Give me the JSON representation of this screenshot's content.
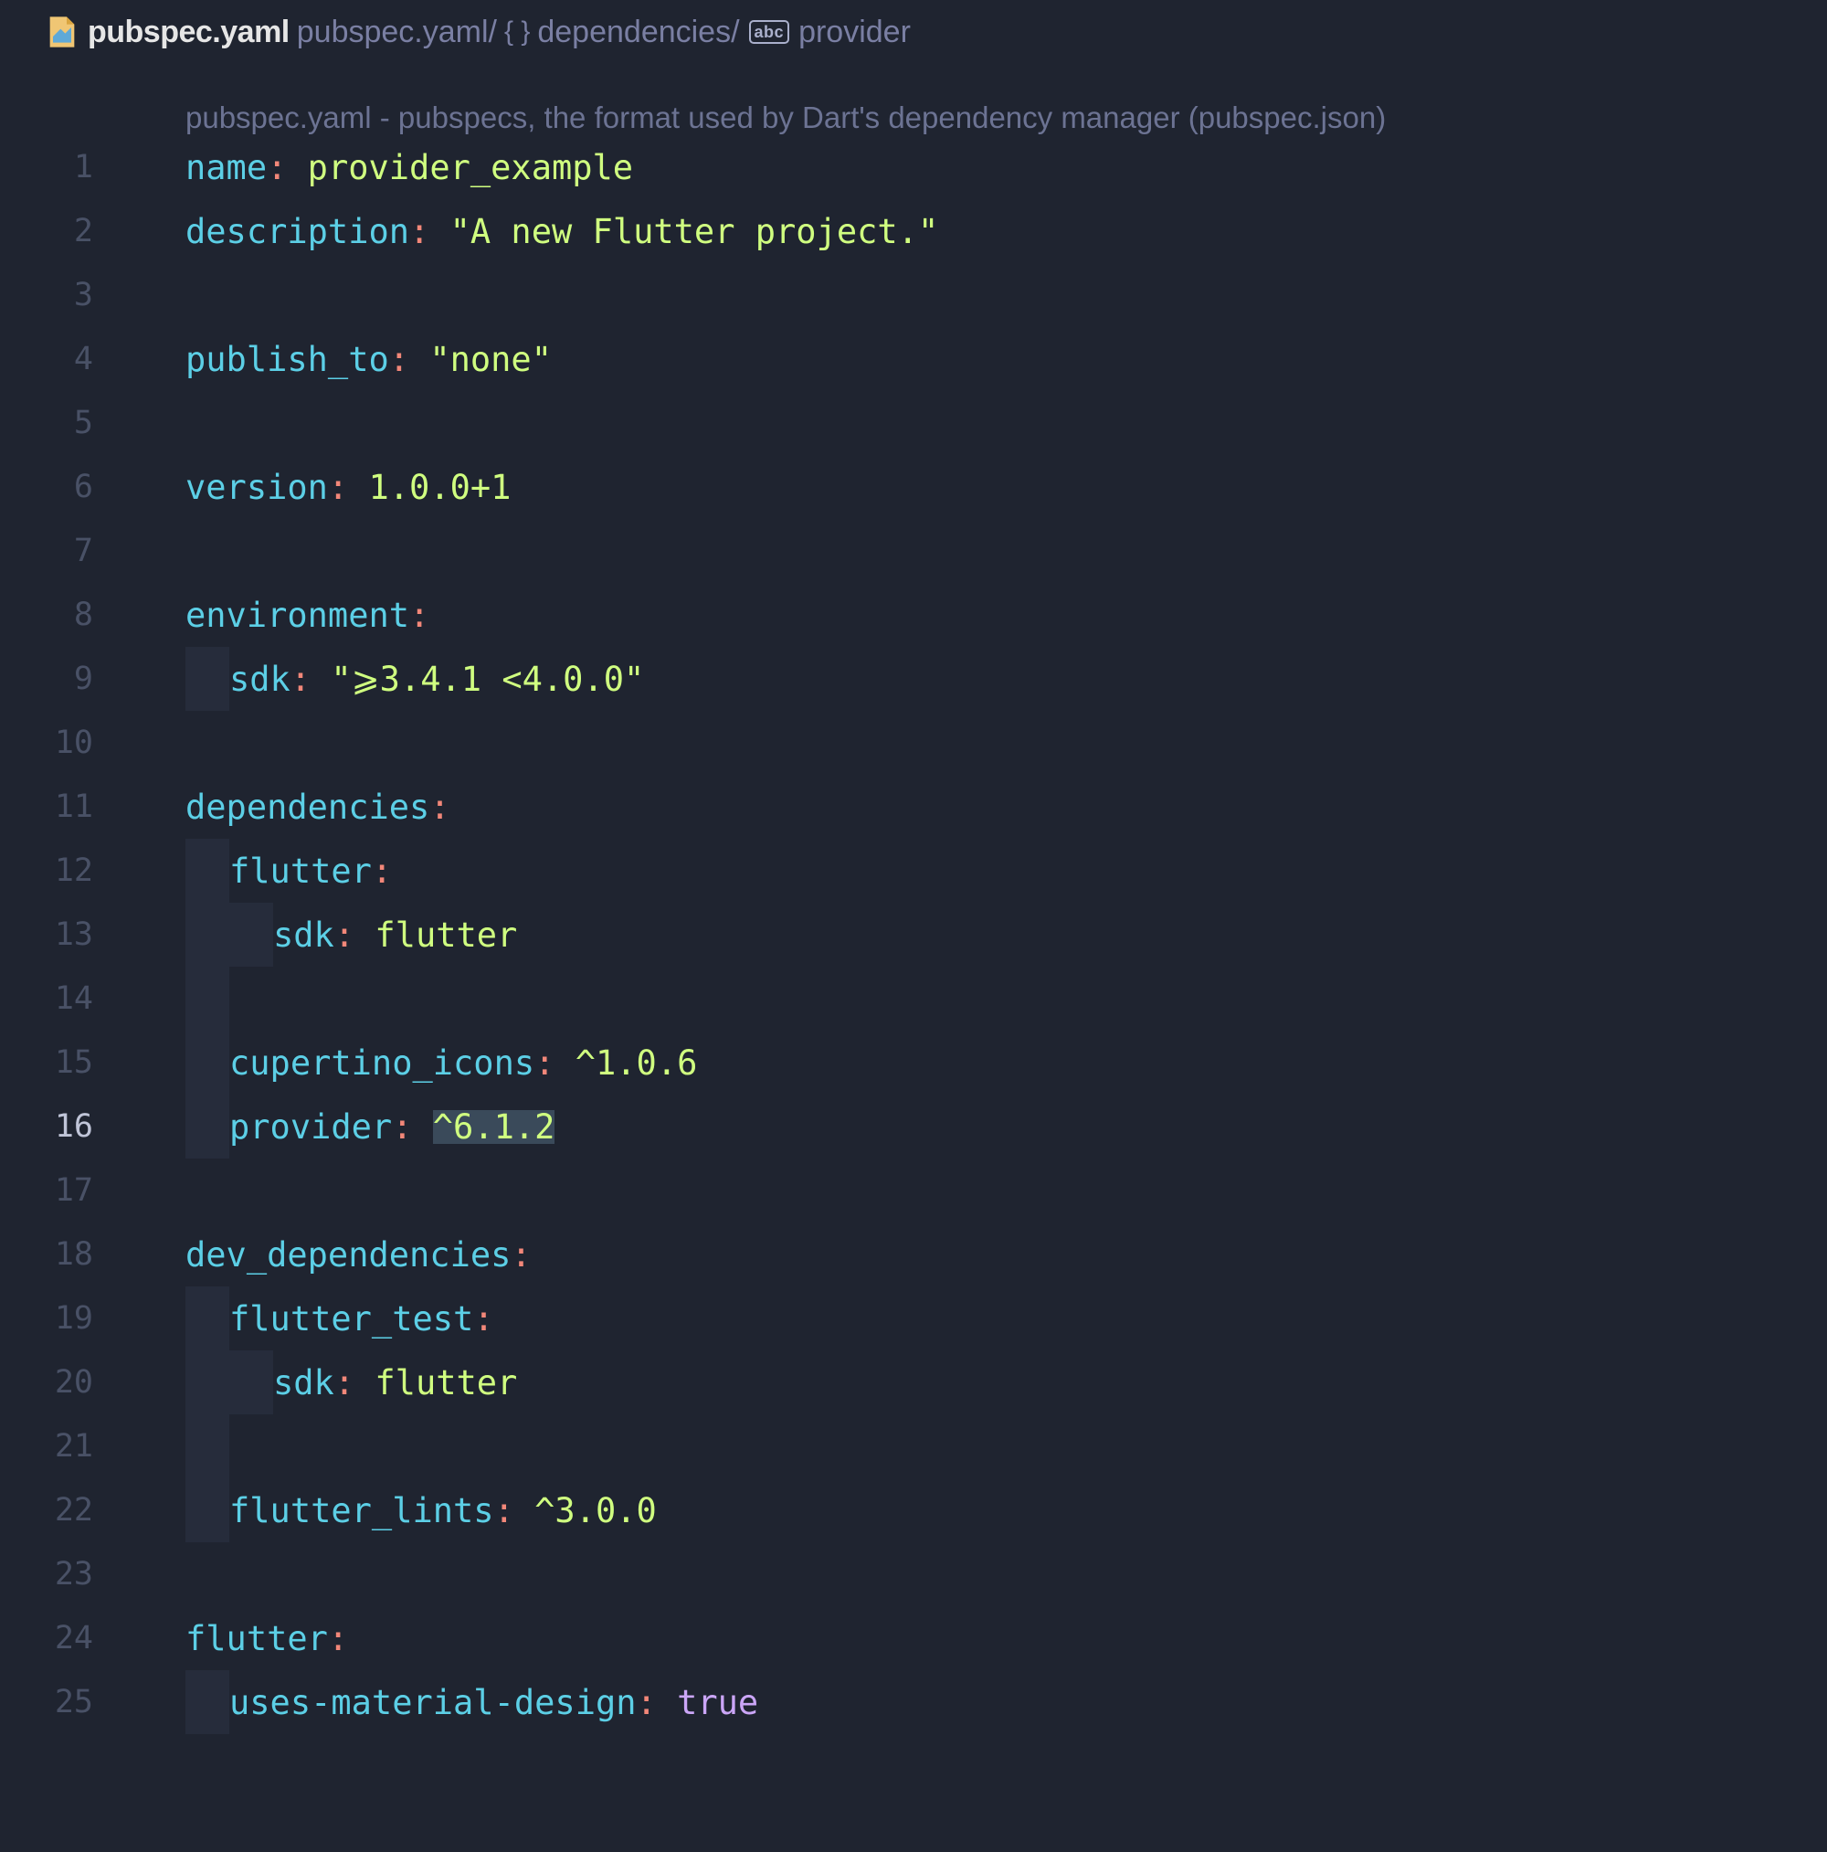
{
  "breadcrumb": {
    "file_active": "pubspec.yaml",
    "file_inactive": "pubspec.yaml/",
    "braces_label": "{ }",
    "path_segment": "dependencies/",
    "abc_badge": "abc",
    "final_segment": "provider"
  },
  "hint": "pubspec.yaml - pubspecs, the format used by Dart's dependency manager (pubspec.json)",
  "code": {
    "current_line": 16,
    "lines": [
      {
        "n": "1",
        "indent": 0,
        "segs": [
          {
            "t": "name",
            "c": "tok-key"
          },
          {
            "t": ":",
            "c": "tok-colon"
          },
          {
            "t": " ",
            "c": ""
          },
          {
            "t": "provider_example",
            "c": "tok-val"
          }
        ]
      },
      {
        "n": "2",
        "indent": 0,
        "segs": [
          {
            "t": "description",
            "c": "tok-key"
          },
          {
            "t": ":",
            "c": "tok-colon"
          },
          {
            "t": " ",
            "c": ""
          },
          {
            "t": "\"A new Flutter project.\"",
            "c": "tok-str"
          }
        ]
      },
      {
        "n": "3",
        "indent": 0,
        "segs": []
      },
      {
        "n": "4",
        "indent": 0,
        "segs": [
          {
            "t": "publish_to",
            "c": "tok-key"
          },
          {
            "t": ":",
            "c": "tok-colon"
          },
          {
            "t": " ",
            "c": ""
          },
          {
            "t": "\"none\"",
            "c": "tok-str"
          }
        ]
      },
      {
        "n": "5",
        "indent": 0,
        "segs": []
      },
      {
        "n": "6",
        "indent": 0,
        "segs": [
          {
            "t": "version",
            "c": "tok-key"
          },
          {
            "t": ":",
            "c": "tok-colon"
          },
          {
            "t": " ",
            "c": ""
          },
          {
            "t": "1.0.0+1",
            "c": "tok-val"
          }
        ]
      },
      {
        "n": "7",
        "indent": 0,
        "segs": []
      },
      {
        "n": "8",
        "indent": 0,
        "segs": [
          {
            "t": "environment",
            "c": "tok-key"
          },
          {
            "t": ":",
            "c": "tok-colon"
          }
        ]
      },
      {
        "n": "9",
        "indent": 1,
        "segs": [
          {
            "t": "sdk",
            "c": "tok-key"
          },
          {
            "t": ":",
            "c": "tok-colon"
          },
          {
            "t": " ",
            "c": ""
          },
          {
            "t": "\"⩾3.4.1 <4.0.0\"",
            "c": "tok-str"
          }
        ]
      },
      {
        "n": "10",
        "indent": 0,
        "segs": []
      },
      {
        "n": "11",
        "indent": 0,
        "segs": [
          {
            "t": "dependencies",
            "c": "tok-key"
          },
          {
            "t": ":",
            "c": "tok-colon"
          }
        ]
      },
      {
        "n": "12",
        "indent": 1,
        "segs": [
          {
            "t": "flutter",
            "c": "tok-key"
          },
          {
            "t": ":",
            "c": "tok-colon"
          }
        ]
      },
      {
        "n": "13",
        "indent": 2,
        "segs": [
          {
            "t": "sdk",
            "c": "tok-key"
          },
          {
            "t": ":",
            "c": "tok-colon"
          },
          {
            "t": " ",
            "c": ""
          },
          {
            "t": "flutter",
            "c": "tok-val"
          }
        ]
      },
      {
        "n": "14",
        "indent": 1,
        "segs": []
      },
      {
        "n": "15",
        "indent": 1,
        "segs": [
          {
            "t": "cupertino_icons",
            "c": "tok-key"
          },
          {
            "t": ":",
            "c": "tok-colon"
          },
          {
            "t": " ",
            "c": ""
          },
          {
            "t": "^1.0.6",
            "c": "tok-val"
          }
        ]
      },
      {
        "n": "16",
        "indent": 1,
        "segs": [
          {
            "t": "provider",
            "c": "tok-key"
          },
          {
            "t": ":",
            "c": "tok-colon"
          },
          {
            "t": " ",
            "c": ""
          },
          {
            "t": "^6.1.2",
            "c": "tok-val",
            "hl": true
          }
        ]
      },
      {
        "n": "17",
        "indent": 0,
        "segs": []
      },
      {
        "n": "18",
        "indent": 0,
        "segs": [
          {
            "t": "dev_dependencies",
            "c": "tok-key"
          },
          {
            "t": ":",
            "c": "tok-colon"
          }
        ]
      },
      {
        "n": "19",
        "indent": 1,
        "segs": [
          {
            "t": "flutter_test",
            "c": "tok-key"
          },
          {
            "t": ":",
            "c": "tok-colon"
          }
        ]
      },
      {
        "n": "20",
        "indent": 2,
        "segs": [
          {
            "t": "sdk",
            "c": "tok-key"
          },
          {
            "t": ":",
            "c": "tok-colon"
          },
          {
            "t": " ",
            "c": ""
          },
          {
            "t": "flutter",
            "c": "tok-val"
          }
        ]
      },
      {
        "n": "21",
        "indent": 1,
        "segs": []
      },
      {
        "n": "22",
        "indent": 1,
        "segs": [
          {
            "t": "flutter_lints",
            "c": "tok-key"
          },
          {
            "t": ":",
            "c": "tok-colon"
          },
          {
            "t": " ",
            "c": ""
          },
          {
            "t": "^3.0.0",
            "c": "tok-val"
          }
        ]
      },
      {
        "n": "23",
        "indent": 0,
        "segs": []
      },
      {
        "n": "24",
        "indent": 0,
        "segs": [
          {
            "t": "flutter",
            "c": "tok-key"
          },
          {
            "t": ":",
            "c": "tok-colon"
          }
        ]
      },
      {
        "n": "25",
        "indent": 1,
        "segs": [
          {
            "t": "uses-material-design",
            "c": "tok-key"
          },
          {
            "t": ":",
            "c": "tok-colon"
          },
          {
            "t": " ",
            "c": ""
          },
          {
            "t": "true",
            "c": "tok-bool"
          }
        ]
      }
    ]
  }
}
